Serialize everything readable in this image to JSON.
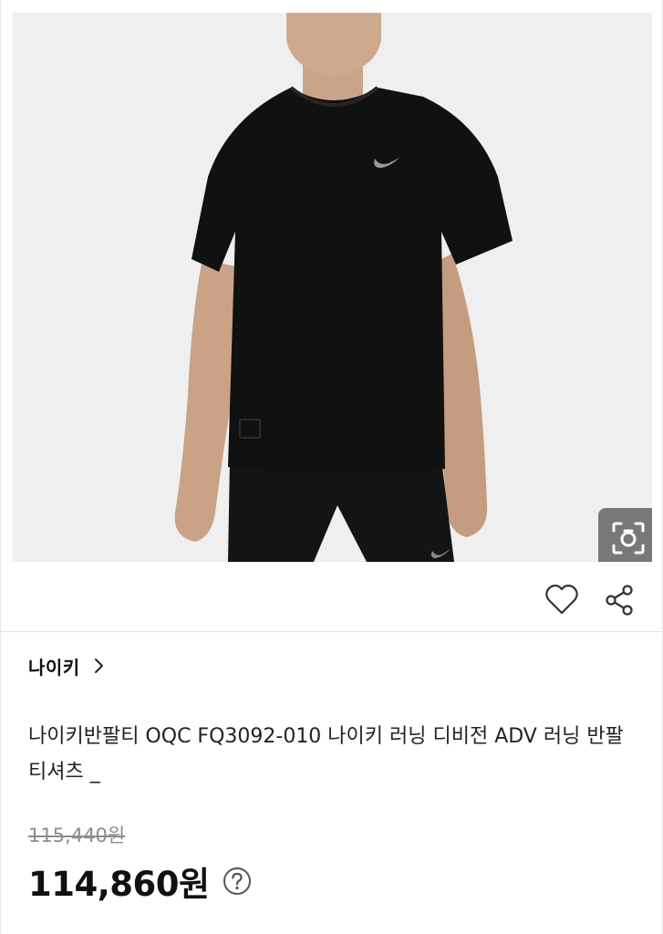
{
  "product": {
    "brand": "나이키",
    "title": "나이키반팔티 OQC FQ3092-010 나이키 러닝 디비전 ADV 러닝 반팔 티셔츠 _",
    "original_price": "115,440원",
    "sale_price": "114,860원",
    "image_icon": "tshirt-model-photo"
  },
  "actions": {
    "lens_icon": "image-search-icon",
    "like_icon": "heart-icon",
    "share_icon": "share-icon",
    "brand_chevron_icon": "chevron-right-icon",
    "help_icon": "question-circle-icon"
  },
  "colors": {
    "background": "#ffffff",
    "image_background": "#efefef",
    "text_primary": "#111111",
    "text_muted": "#8c8c8c",
    "divider": "#e4e4e4"
  }
}
